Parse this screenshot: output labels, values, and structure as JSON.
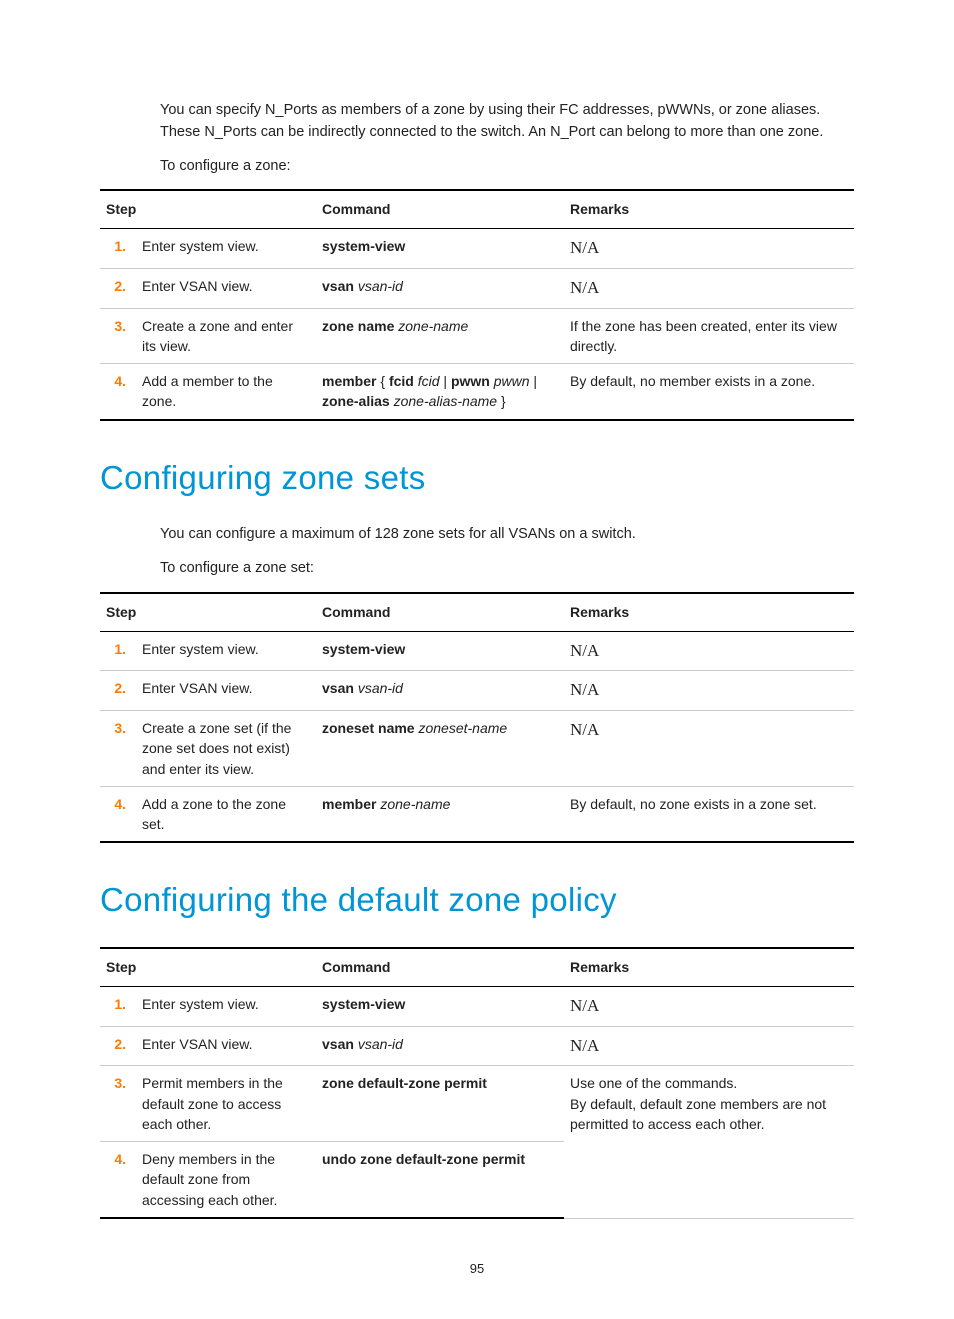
{
  "intro1": "You can specify N_Ports as members of a zone by using their FC addresses, pWWNs, or zone aliases. These N_Ports can be indirectly connected to the switch. An N_Port can belong to more than one zone.",
  "intro2": "To configure a zone:",
  "headers": {
    "step": "Step",
    "command": "Command",
    "remarks": "Remarks"
  },
  "table1": {
    "rows": [
      {
        "n": "1.",
        "step": "Enter system view.",
        "cmd": [
          [
            "b",
            "system-view"
          ]
        ],
        "rem": [
          [
            "na",
            "N/A"
          ]
        ]
      },
      {
        "n": "2.",
        "step": "Enter VSAN view.",
        "cmd": [
          [
            "b",
            "vsan"
          ],
          [
            "t",
            " "
          ],
          [
            "i",
            "vsan-id"
          ]
        ],
        "rem": [
          [
            "na",
            "N/A"
          ]
        ]
      },
      {
        "n": "3.",
        "step": "Create a zone and enter its view.",
        "cmd": [
          [
            "b",
            "zone name"
          ],
          [
            "t",
            " "
          ],
          [
            "i",
            "zone-name"
          ]
        ],
        "rem": [
          [
            "t",
            "If the zone has been created, enter its view directly."
          ]
        ]
      },
      {
        "n": "4.",
        "step": "Add a member to the zone.",
        "cmd": [
          [
            "b",
            "member"
          ],
          [
            "t",
            " { "
          ],
          [
            "b",
            "fcid"
          ],
          [
            "t",
            " "
          ],
          [
            "i",
            "fcid"
          ],
          [
            "t",
            " | "
          ],
          [
            "b",
            "pwwn"
          ],
          [
            "t",
            " "
          ],
          [
            "i",
            "pwwn"
          ],
          [
            "t",
            " | "
          ],
          [
            "b",
            "zone-alias"
          ],
          [
            "t",
            " "
          ],
          [
            "i",
            "zone-alias-name"
          ],
          [
            "t",
            " }"
          ]
        ],
        "rem": [
          [
            "t",
            "By default, no member exists in a zone."
          ]
        ]
      }
    ]
  },
  "h2": "Configuring zone sets",
  "p2a": "You can configure a maximum of 128 zone sets for all VSANs on a switch.",
  "p2b": "To configure a zone set:",
  "table2": {
    "rows": [
      {
        "n": "1.",
        "step": "Enter system view.",
        "cmd": [
          [
            "b",
            "system-view"
          ]
        ],
        "rem": [
          [
            "na",
            "N/A"
          ]
        ]
      },
      {
        "n": "2.",
        "step": "Enter VSAN view.",
        "cmd": [
          [
            "b",
            "vsan"
          ],
          [
            "t",
            " "
          ],
          [
            "i",
            "vsan-id"
          ]
        ],
        "rem": [
          [
            "na",
            "N/A"
          ]
        ]
      },
      {
        "n": "3.",
        "step": "Create a zone set (if the zone set does not exist) and enter its view.",
        "cmd": [
          [
            "b",
            "zoneset name"
          ],
          [
            "t",
            " "
          ],
          [
            "i",
            "zoneset-name"
          ]
        ],
        "rem": [
          [
            "na",
            "N/A"
          ]
        ]
      },
      {
        "n": "4.",
        "step": "Add a zone to the zone set.",
        "cmd": [
          [
            "b",
            "member"
          ],
          [
            "t",
            " "
          ],
          [
            "i",
            "zone-name"
          ]
        ],
        "rem": [
          [
            "t",
            "By default, no zone exists in a zone set."
          ]
        ]
      }
    ]
  },
  "h3": "Configuring the default zone policy",
  "table3": {
    "rows": [
      {
        "n": "1.",
        "step": "Enter system view.",
        "cmd": [
          [
            "b",
            "system-view"
          ]
        ],
        "rem": [
          [
            "na",
            "N/A"
          ]
        ]
      },
      {
        "n": "2.",
        "step": "Enter VSAN view.",
        "cmd": [
          [
            "b",
            "vsan"
          ],
          [
            "t",
            " "
          ],
          [
            "i",
            "vsan-id"
          ]
        ],
        "rem": [
          [
            "na",
            "N/A"
          ]
        ]
      }
    ],
    "merged": {
      "row3": {
        "n": "3.",
        "step": "Permit members in the default zone to access each other.",
        "cmd": [
          [
            "b",
            "zone default-zone permit"
          ]
        ]
      },
      "row4": {
        "n": "4.",
        "step": "Deny members in the default zone from accessing each other.",
        "cmd": [
          [
            "b",
            "undo zone default-zone permit"
          ]
        ]
      },
      "rem1": "Use one of the commands.",
      "rem2": "By default, default zone members are not permitted to access each other."
    }
  },
  "page": "95"
}
